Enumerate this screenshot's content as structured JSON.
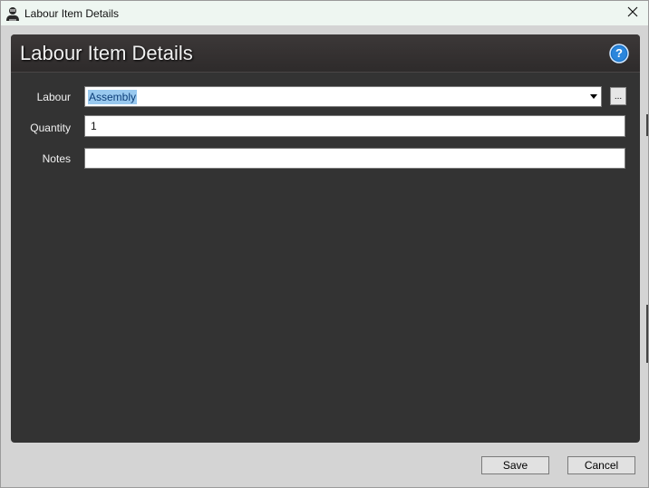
{
  "window": {
    "title": "Labour Item Details",
    "close_glyph": "✕"
  },
  "panel": {
    "title": "Labour Item Details",
    "help_glyph": "?"
  },
  "form": {
    "labour": {
      "label": "Labour",
      "value": "Assembly",
      "browse_label": "..."
    },
    "quantity": {
      "label": "Quantity",
      "value": "1"
    },
    "notes": {
      "label": "Notes",
      "value": ""
    }
  },
  "buttons": {
    "save_label": "Save",
    "cancel_label": "Cancel"
  },
  "colors": {
    "panel_bg": "#333333",
    "titlebar_bg": "#eef6f1",
    "selection_bg": "#99c9ef",
    "help_blue": "#1a73c8"
  }
}
